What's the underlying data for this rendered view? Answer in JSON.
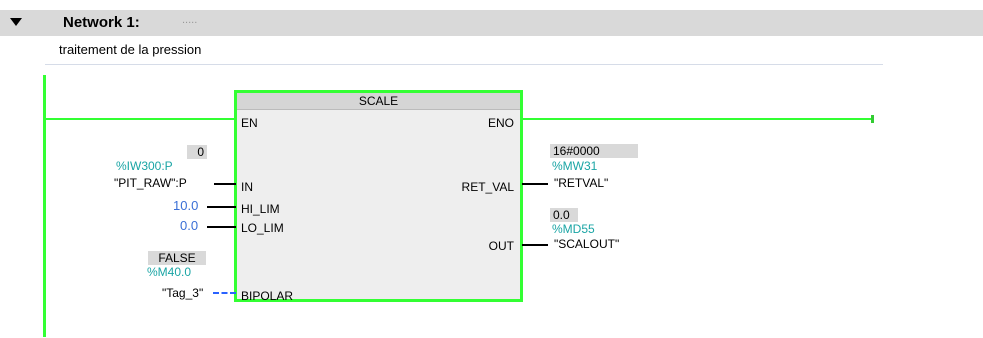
{
  "network": {
    "title": "Network 1:",
    "dots": "....."
  },
  "comment": "traitement de la pression",
  "block": {
    "name": "SCALE",
    "en": "EN",
    "eno": "ENO",
    "in_pin": "IN",
    "hi_lim_pin": "HI_LIM",
    "lo_lim_pin": "LO_LIM",
    "bipolar_pin": "BIPOLAR",
    "ret_val_pin": "RET_VAL",
    "out_pin": "OUT"
  },
  "inputs": {
    "in_value": "0",
    "in_address": "%IW300:P",
    "in_tag": "\"PIT_RAW\":P",
    "hi_lim_value": "10.0",
    "lo_lim_value": "0.0",
    "bipolar_value": "FALSE",
    "bipolar_address": "%M40.0",
    "bipolar_tag": "\"Tag_3\""
  },
  "outputs": {
    "ret_val_value": "16#0000",
    "ret_val_address": "%MW31",
    "ret_val_tag": "\"RETVAL\"",
    "out_value": "0.0",
    "out_address": "%MD55",
    "out_tag": "\"SCALOUT\""
  },
  "colors": {
    "wire_active": "#33ff33",
    "address": "#1aa5a5",
    "constant": "#3a6fd6",
    "dashed_link": "#2a62ff"
  }
}
